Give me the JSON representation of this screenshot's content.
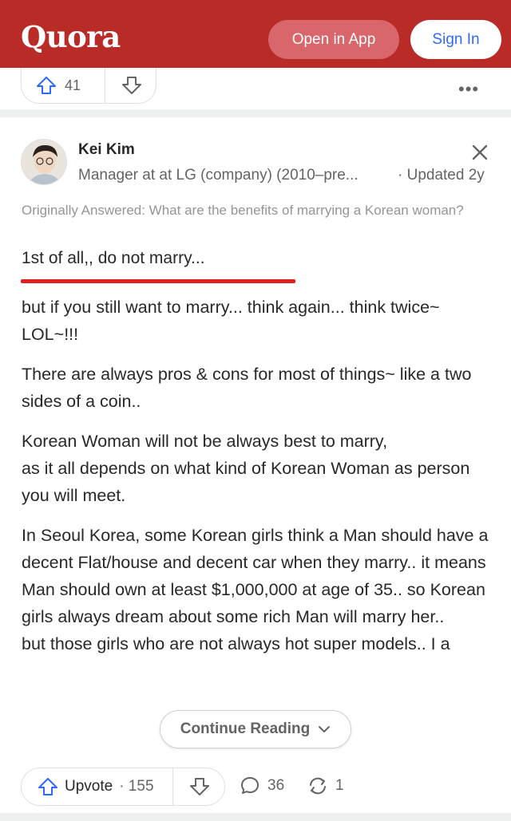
{
  "header": {
    "logo": "Quora",
    "open_in_app": "Open in App",
    "sign_in": "Sign In"
  },
  "prev_answer": {
    "upvote_count": "41",
    "more": "•••"
  },
  "answer": {
    "author": "Kei Kim",
    "credential": "Manager at at LG (company) (2010–pre...",
    "updated": "· Updated 2y",
    "originally_answered": "Originally Answered: What are the benefits of marrying a Korean woman?",
    "first_line": "1st of all,, do not marry...",
    "paragraphs": [
      "but if you still want to marry... think again... think twice~",
      "LOL~!!!",
      "There are always pros & cons for most of things~ like a two sides of a coin..",
      "Korean Woman will not be always best to marry,",
      "as it all depends on what kind of Korean Woman as person you will meet.",
      "In Seoul Korea, some Korean girls think a Man should have a decent Flat/house and decent car when they marry.. it means Man should own at least $1,000,000 at age of 35.. so Korean girls always dream about some rich Man will marry her..",
      "but those girls who are not always hot super models.. I a"
    ],
    "continue_reading": "Continue Reading"
  },
  "actions": {
    "upvote_label": "Upvote",
    "upvote_count": "· 155",
    "comments": "36",
    "shares": "1"
  },
  "colors": {
    "brand": "#b92b27",
    "accent_blue": "#2e69ff",
    "highlight_red": "#e02020"
  },
  "icons": [
    "upvote-icon",
    "downvote-icon",
    "more-icon",
    "close-icon",
    "chevron-down-icon",
    "comment-icon",
    "share-icon"
  ]
}
